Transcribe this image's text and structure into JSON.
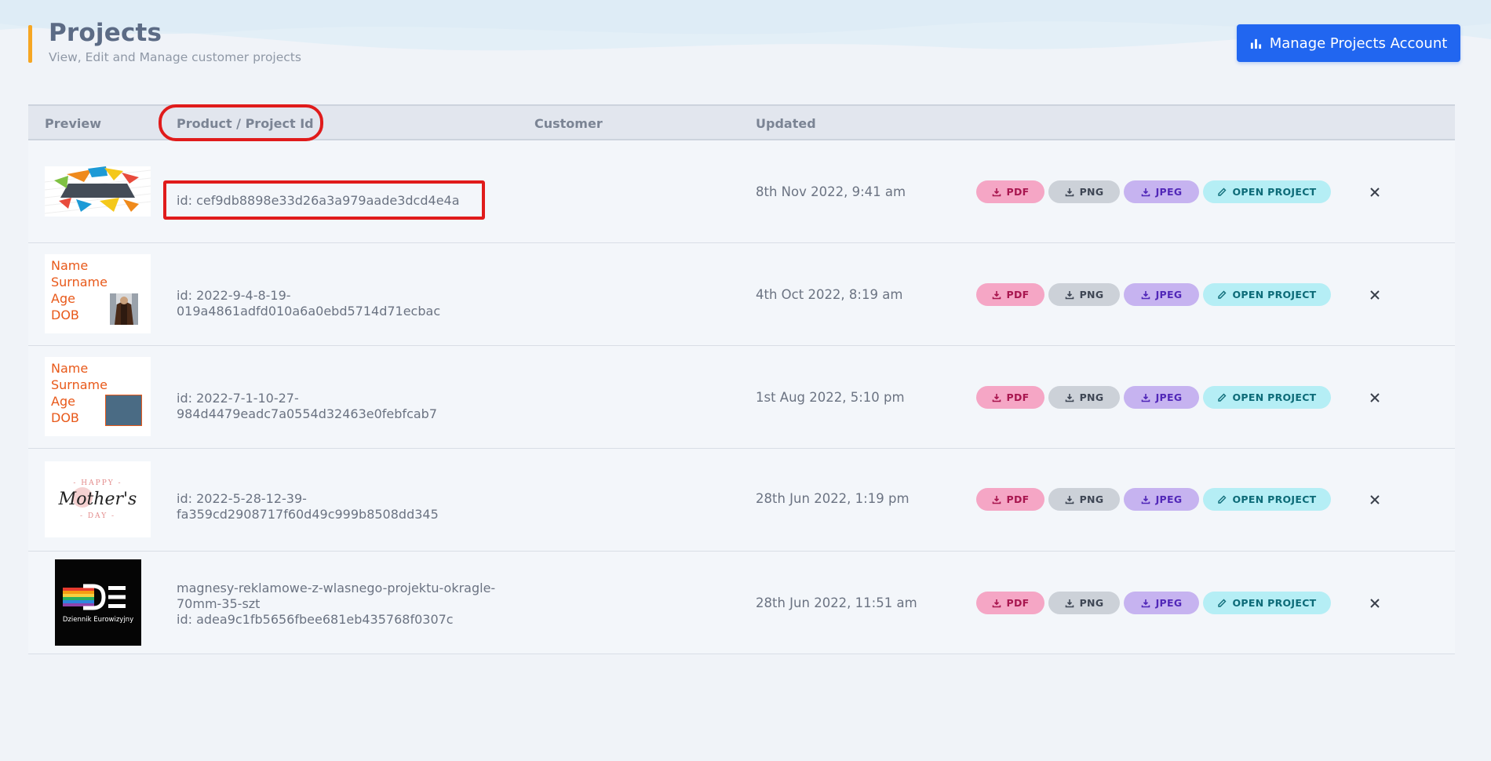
{
  "header": {
    "title": "Projects",
    "subtitle": "View, Edit and Manage customer projects",
    "manage_button": "Manage Projects Account",
    "manage_icon": "bar-chart-icon",
    "accent_color": "#f6a623",
    "button_color": "#2166f0"
  },
  "table": {
    "columns": [
      "Preview",
      "Product / Project Id",
      "Customer",
      "Updated"
    ],
    "action_labels": {
      "pdf": "PDF",
      "png": "PNG",
      "jpeg": "JPEG",
      "open": "OPEN PROJECT"
    },
    "rows": [
      {
        "preview": "colorful-banner-thumbnail",
        "id_line1": "id: cef9db8898e33d26a3a979aade3dcd4e4a",
        "id_line2": "",
        "id_line3": "",
        "updated": "8th Nov 2022, 9:41 am"
      },
      {
        "preview": "name-card-with-photo",
        "card_lines": [
          "Name",
          "Surname",
          "Age",
          "DOB"
        ],
        "id_line1": "id: 2022-9-4-8-19-",
        "id_line2": "019a4861adfd010a6a0ebd5714d71ecbac",
        "id_line3": "",
        "updated": "4th Oct 2022, 8:19 am"
      },
      {
        "preview": "name-card-with-box",
        "card_lines": [
          "Name",
          "Surname",
          "Age",
          "DOB"
        ],
        "id_line1": "id: 2022-7-1-10-27-",
        "id_line2": "984d4479eadc7a0554d32463e0febfcab7",
        "id_line3": "",
        "updated": "1st Aug 2022, 5:10 pm"
      },
      {
        "preview": "happy-mothers-day-card",
        "card_lines": [
          "- HAPPY -",
          "Mother's",
          "- DAY -"
        ],
        "id_line1": "id: 2022-5-28-12-39-",
        "id_line2": "fa359cd2908717f60d49c999b8508dd345",
        "id_line3": "",
        "updated": "28th Jun 2022, 1:19 pm"
      },
      {
        "preview": "dziennik-eurowizyjny-logo",
        "card_lines": [
          "DE",
          "Dziennik Eurowizyjny"
        ],
        "id_line1": "magnesy-reklamowe-z-wlasnego-projektu-okragle-",
        "id_line2": "70mm-35-szt",
        "id_line3": "id: adea9c1fb5656fbee681eb435768f0307c",
        "updated": "28th Jun 2022, 11:51 am"
      }
    ]
  }
}
